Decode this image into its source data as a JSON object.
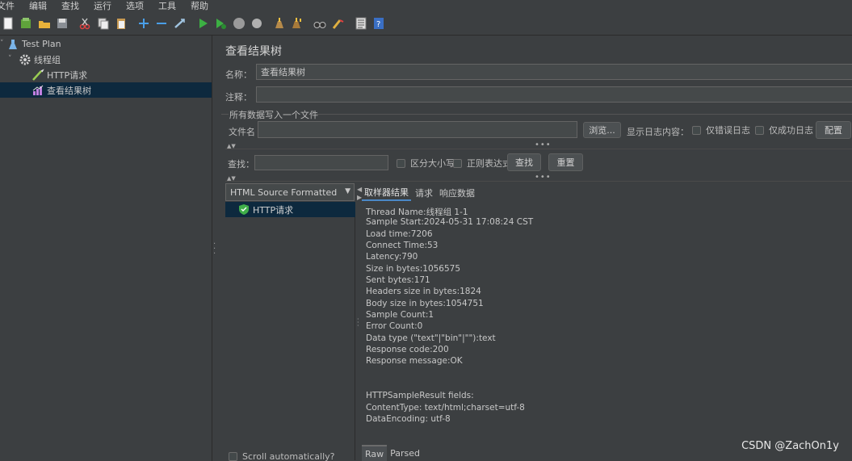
{
  "menu": [
    "文件",
    "编辑",
    "查找",
    "运行",
    "选项",
    "工具",
    "帮助"
  ],
  "toolbar_icons": [
    "new-icon",
    "templates-icon",
    "open-icon",
    "save-icon",
    "cut-icon",
    "copy-icon",
    "paste-icon",
    "expand-icon",
    "collapse-icon",
    "toggle-icon",
    "start-icon",
    "start-no-pause-icon",
    "stop-icon",
    "shutdown-icon",
    "clear-icon",
    "clear-all-icon",
    "search-binoculars-icon",
    "reset-search-icon",
    "function-helper-icon",
    "help-icon"
  ],
  "tree": {
    "items": [
      {
        "label": "Test Plan",
        "icon": "test-plan-icon"
      },
      {
        "label": "线程组",
        "icon": "thread-group-gear-icon"
      },
      {
        "label": "HTTP请求",
        "icon": "http-sampler-pen-icon"
      },
      {
        "label": "查看结果树",
        "icon": "results-tree-icon"
      }
    ]
  },
  "panel": {
    "title": "查看结果树",
    "name_label": "名称：",
    "name_value": "查看结果树",
    "comment_label": "注释：",
    "comment_value": "",
    "file_group_label": "所有数据写入一个文件",
    "filename_label": "文件名",
    "filename_value": "",
    "browse_button": "浏览...",
    "log_display_label": "显示日志内容：",
    "errors_only_label": "仅错误日志",
    "success_only_label": "仅成功日志",
    "configure_button": "配置",
    "search_label": "查找：",
    "search_value": "",
    "case_sensitive_label": "区分大小写",
    "regex_label": "正则表达式",
    "find_button": "查找",
    "reset_button": "重置",
    "renderer_selected": "HTML Source Formatted",
    "result_item": "HTTP请求",
    "tabs": [
      "取样器结果",
      "请求",
      "响应数据"
    ],
    "scroll_auto_label": "Scroll automatically?",
    "detail_lines": [
      "Thread Name:线程组 1-1",
      "Sample Start:2024-05-31 17:08:24 CST",
      "Load time:7206",
      "Connect Time:53",
      "Latency:790",
      "Size in bytes:1056575",
      "Sent bytes:171",
      "Headers size in bytes:1824",
      "Body size in bytes:1054751",
      "Sample Count:1",
      "Error Count:0",
      "Data type (\"text\"|\"bin\"|\"\"):text",
      "Response code:200",
      "Response message:OK",
      "",
      "",
      "HTTPSampleResult fields:",
      "ContentType: text/html;charset=utf-8",
      "DataEncoding: utf-8"
    ],
    "bottom_tabs": [
      "Raw",
      "Parsed"
    ]
  },
  "watermark": "CSDN @ZachOn1y"
}
